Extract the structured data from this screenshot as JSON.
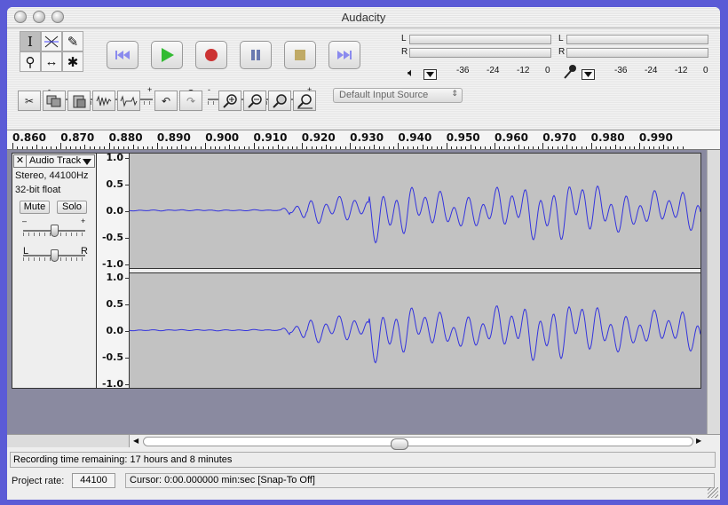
{
  "window": {
    "title": "Audacity"
  },
  "tools": {
    "selection": "I",
    "envelope": "envelope",
    "draw": "✎",
    "zoom": "⚲",
    "timeshift": "↔",
    "multi": "✱"
  },
  "transport": {
    "skip_start": "skip-start-icon",
    "play": "play-icon",
    "record": "record-icon",
    "pause": "pause-icon",
    "stop": "stop-icon",
    "skip_end": "skip-end-icon"
  },
  "meters": {
    "output": {
      "L": "L",
      "R": "R",
      "ticks": [
        "-36",
        "-24",
        "-12",
        "0"
      ]
    },
    "input": {
      "L": "L",
      "R": "R",
      "ticks": [
        "-36",
        "-24",
        "-12",
        "0"
      ]
    }
  },
  "mixer": {
    "out_minus": "-",
    "out_plus": "+",
    "in_minus": "-",
    "in_plus": "+",
    "input_source": "Default Input Source"
  },
  "ruler": {
    "labels": [
      "0.860",
      "0.870",
      "0.880",
      "0.890",
      "0.900",
      "0.910",
      "0.920",
      "0.930",
      "0.940",
      "0.950",
      "0.960",
      "0.970",
      "0.980",
      "0.990"
    ]
  },
  "track": {
    "close": "✕",
    "name": "Audio Track",
    "format": "Stereo, 44100Hz",
    "bitdepth": "32-bit float",
    "mute": "Mute",
    "solo": "Solo",
    "gain_minus": "–",
    "gain_plus": "+",
    "pan_left": "L",
    "pan_right": "R",
    "channel1_labels": [
      "1.0",
      "0.5",
      "0.0",
      "-0.5",
      "-1.0"
    ],
    "channel2_labels": [
      "1.0",
      "0.5",
      "0.0",
      "-0.5",
      "-1.0"
    ]
  },
  "status": {
    "recording_time": "Recording time remaining: 17 hours and 8 minutes"
  },
  "bottom": {
    "project_rate_label": "Project rate:",
    "project_rate": "44100",
    "cursor": "Cursor: 0:00.000000 min:sec  [Snap-To Off]"
  }
}
